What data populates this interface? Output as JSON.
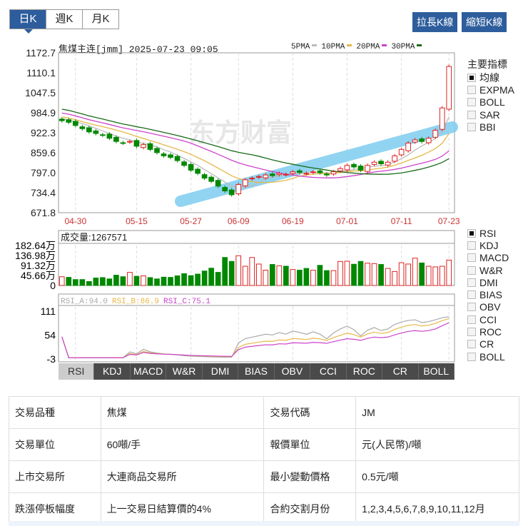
{
  "period_tabs": [
    "日K",
    "週K",
    "月K"
  ],
  "buttons": {
    "lengthen": "拉長K線",
    "shorten": "縮短K線"
  },
  "chart": {
    "title": "焦煤主连[jmm] 2025-07-23 09:05",
    "ma_legend": [
      {
        "label": "5PMA",
        "color": "#bbbbbb"
      },
      {
        "label": "10PMA",
        "color": "#e6b84a"
      },
      {
        "label": "20PMA",
        "color": "#cc44cc"
      },
      {
        "label": "30PMA",
        "color": "#1a6b1a"
      }
    ],
    "price_ticks": [
      "1172.7",
      "1110.1",
      "1047.5",
      "984.9",
      "922.3",
      "859.6",
      "797.0",
      "734.4",
      "671.8"
    ],
    "price_range": [
      671.8,
      1172.7
    ],
    "date_labels": [
      {
        "label": "04-30",
        "i": 2
      },
      {
        "label": "05-15",
        "i": 11
      },
      {
        "label": "05-27",
        "i": 19
      },
      {
        "label": "06-09",
        "i": 26
      },
      {
        "label": "06-19",
        "i": 34
      },
      {
        "label": "07-01",
        "i": 42
      },
      {
        "label": "07-11",
        "i": 50
      },
      {
        "label": "07-23",
        "i": 57
      }
    ],
    "closes": [
      960,
      955,
      945,
      935,
      925,
      920,
      915,
      905,
      895,
      890,
      895,
      880,
      885,
      870,
      860,
      850,
      845,
      835,
      820,
      805,
      795,
      780,
      770,
      755,
      740,
      728,
      760,
      775,
      780,
      785,
      790,
      788,
      795,
      792,
      800,
      798,
      795,
      800,
      797,
      790,
      800,
      810,
      820,
      815,
      805,
      820,
      830,
      825,
      830,
      850,
      870,
      890,
      900,
      895,
      905,
      930,
      1000,
      1130
    ],
    "volume_label": "成交量:1267571",
    "volume_ticks": [
      "182.64万",
      "136.98万",
      "91.32万",
      "45.66万",
      "0"
    ],
    "volume_max": 182.64,
    "volumes": [
      40,
      37,
      27,
      27,
      18,
      34,
      36,
      30,
      47,
      40,
      60,
      42,
      44,
      36,
      30,
      38,
      37,
      44,
      54,
      45,
      52,
      66,
      79,
      60,
      128,
      110,
      136,
      88,
      128,
      98,
      70,
      96,
      90,
      88,
      73,
      70,
      78,
      70,
      92,
      68,
      68,
      110,
      111,
      97,
      110,
      102,
      100,
      96,
      78,
      64,
      104,
      98,
      125,
      103,
      88,
      85,
      88,
      116,
      133,
      133,
      108
    ],
    "rsi_legend": [
      {
        "label": "RSI_A:94.0",
        "color": "#aaaaaa"
      },
      {
        "label": "RSI_B:86.9",
        "color": "#e6b84a"
      },
      {
        "label": "RSI_C:75.1",
        "color": "#cc44cc"
      }
    ],
    "rsi_ticks": [
      "111",
      "54",
      "-3"
    ],
    "rsi_range": [
      -3,
      111
    ],
    "watermark": "东方财富"
  },
  "main_indicators": {
    "title": "主要指標",
    "items": [
      {
        "label": "均線",
        "checked": true
      },
      {
        "label": "EXPMA",
        "checked": false
      },
      {
        "label": "BOLL",
        "checked": false
      },
      {
        "label": "SAR",
        "checked": false
      },
      {
        "label": "BBI",
        "checked": false
      }
    ]
  },
  "sub_indicators": [
    {
      "label": "RSI",
      "checked": true
    },
    {
      "label": "KDJ",
      "checked": false
    },
    {
      "label": "MACD",
      "checked": false
    },
    {
      "label": "W&R",
      "checked": false
    },
    {
      "label": "DMI",
      "checked": false
    },
    {
      "label": "BIAS",
      "checked": false
    },
    {
      "label": "OBV",
      "checked": false
    },
    {
      "label": "CCI",
      "checked": false
    },
    {
      "label": "ROC",
      "checked": false
    },
    {
      "label": "CR",
      "checked": false
    },
    {
      "label": "BOLL",
      "checked": false
    }
  ],
  "indicator_tabs": [
    "RSI",
    "KDJ",
    "MACD",
    "W&R",
    "DMI",
    "BIAS",
    "OBV",
    "CCI",
    "ROC",
    "CR",
    "BOLL"
  ],
  "spec_table": [
    [
      "交易品種",
      "焦煤",
      "交易代碼",
      "JM"
    ],
    [
      "交易單位",
      "60噸/手",
      "報價單位",
      "元(人民幣)/噸"
    ],
    [
      "上市交易所",
      "大連商品交易所",
      "最小變動價格",
      "0.5元/噸"
    ],
    [
      "跌漲停板幅度",
      "上一交易日結算價的4%",
      "合約交割月份",
      "1,2,3,4,5,6,7,8,9,10,11,12月"
    ]
  ]
}
